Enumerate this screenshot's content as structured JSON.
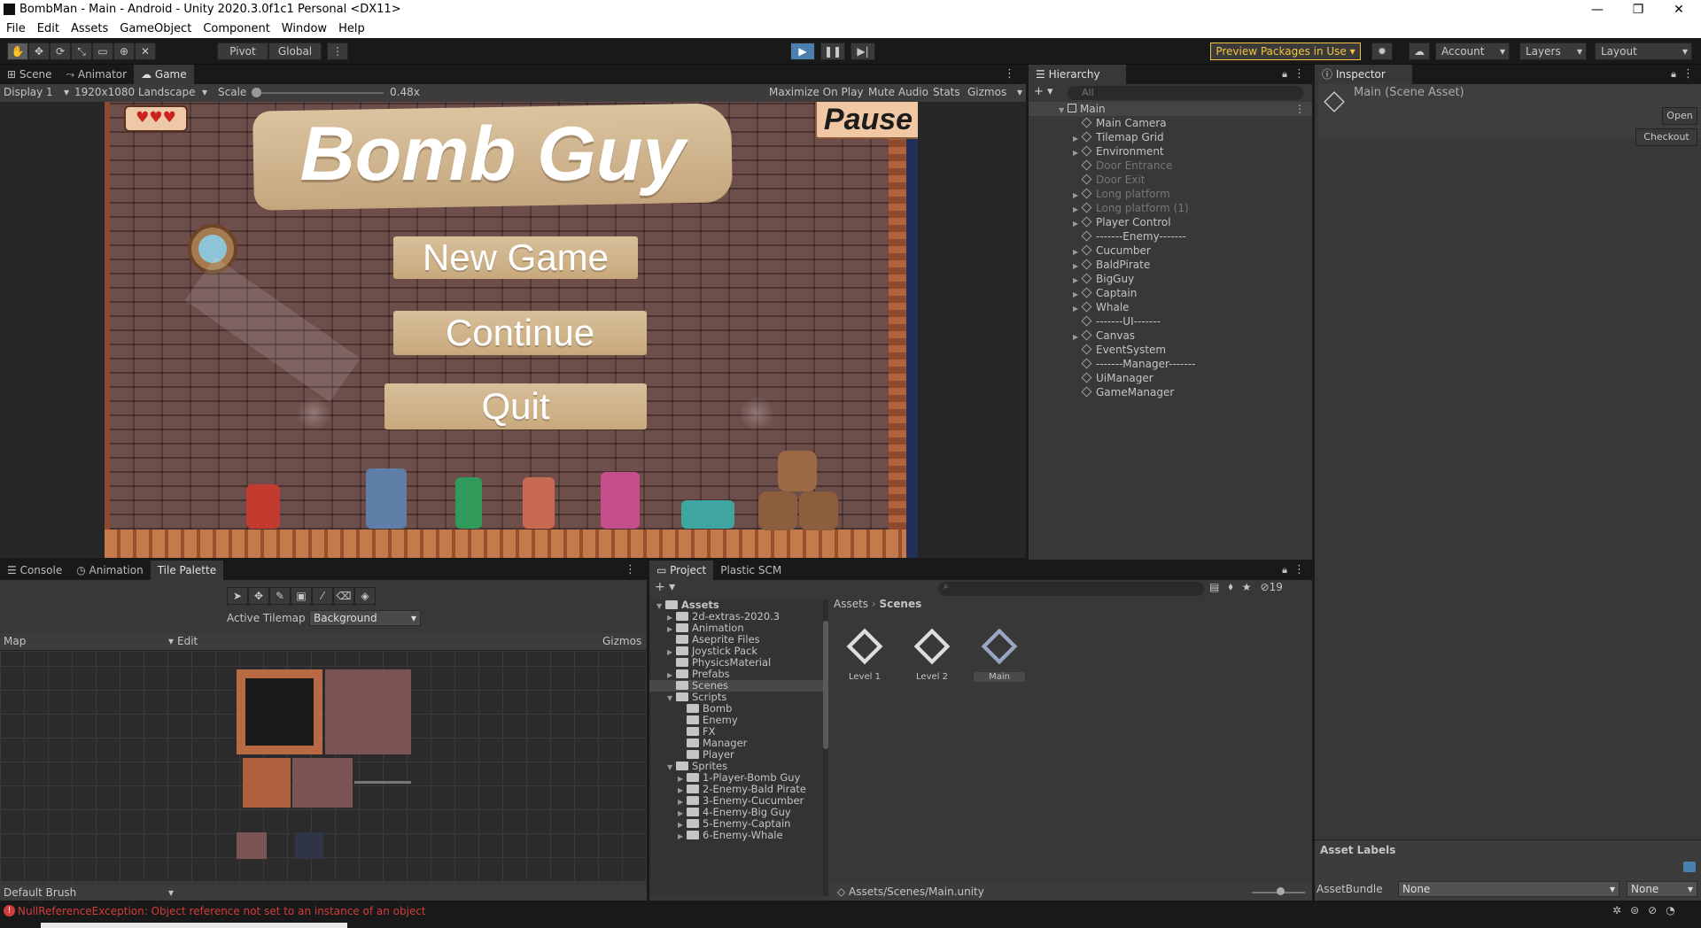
{
  "window": {
    "title": "BombMan - Main - Android - Unity 2020.3.0f1c1 Personal <DX11>"
  },
  "menu": [
    "File",
    "Edit",
    "Assets",
    "GameObject",
    "Component",
    "Window",
    "Help"
  ],
  "toolbar": {
    "pivot": "Pivot",
    "global": "Global",
    "preview_packages": "Preview Packages in Use",
    "account": "Account",
    "layers": "Layers",
    "layout": "Layout"
  },
  "game_panel": {
    "tabs": [
      "Scene",
      "Animator",
      "Game"
    ],
    "display": "Display 1",
    "resolution": "1920x1080 Landscape",
    "scale_label": "Scale",
    "scale_value": "0.48x",
    "scale_fraction": 0.05,
    "maximize": "Maximize On Play",
    "mute": "Mute Audio",
    "stats": "Stats",
    "gizmos": "Gizmos"
  },
  "game_view": {
    "title": "Bomb Guy",
    "pause": "Pause",
    "buttons": [
      "New Game",
      "Continue",
      "Quit"
    ],
    "hearts": "♥♥♥"
  },
  "hierarchy": {
    "tab": "Hierarchy",
    "search_placeholder": "All",
    "scene": "Main",
    "items": [
      {
        "label": "Main Camera",
        "arrow": false,
        "dim": false
      },
      {
        "label": "Tilemap Grid",
        "arrow": true,
        "dim": false
      },
      {
        "label": "Environment",
        "arrow": true,
        "dim": false
      },
      {
        "label": "Door Entrance",
        "arrow": false,
        "dim": true
      },
      {
        "label": "Door Exit",
        "arrow": false,
        "dim": true
      },
      {
        "label": "Long platform",
        "arrow": true,
        "dim": true
      },
      {
        "label": "Long platform (1)",
        "arrow": true,
        "dim": true
      },
      {
        "label": "Player Control",
        "arrow": true,
        "dim": false
      },
      {
        "label": "-------Enemy-------",
        "arrow": false,
        "dim": false
      },
      {
        "label": "Cucumber",
        "arrow": true,
        "dim": false
      },
      {
        "label": "BaldPirate",
        "arrow": true,
        "dim": false
      },
      {
        "label": "BigGuy",
        "arrow": true,
        "dim": false
      },
      {
        "label": "Captain",
        "arrow": true,
        "dim": false
      },
      {
        "label": "Whale",
        "arrow": true,
        "dim": false
      },
      {
        "label": "-------UI-------",
        "arrow": false,
        "dim": false
      },
      {
        "label": "Canvas",
        "arrow": true,
        "dim": false
      },
      {
        "label": "EventSystem",
        "arrow": false,
        "dim": false
      },
      {
        "label": "-------Manager-------",
        "arrow": false,
        "dim": false
      },
      {
        "label": "UiManager",
        "arrow": false,
        "dim": false
      },
      {
        "label": "GameManager",
        "arrow": false,
        "dim": false
      }
    ]
  },
  "inspector": {
    "tab": "Inspector",
    "title": "Main (Scene Asset)",
    "open": "Open",
    "checkout": "Checkout",
    "asset_labels": "Asset Labels",
    "asset_bundle": "AssetBundle",
    "bundle_value": "None",
    "variant_value": "None"
  },
  "tile_palette": {
    "tabs": [
      "Console",
      "Animation",
      "Tile Palette"
    ],
    "active_tilemap_label": "Active Tilemap",
    "active_tilemap_value": "Background",
    "map": "Map",
    "edit": "Edit",
    "gizmos": "Gizmos",
    "brush": "Default Brush"
  },
  "project": {
    "tabs": [
      "Project",
      "Plastic SCM"
    ],
    "hidden_count": "19",
    "breadcrumb_root": "Assets",
    "breadcrumb_leaf": "Scenes",
    "tree": [
      {
        "label": "Assets",
        "depth": 0,
        "open": true,
        "arrow": true,
        "bold": true
      },
      {
        "label": "2d-extras-2020.3",
        "depth": 1,
        "arrow": true
      },
      {
        "label": "Animation",
        "depth": 1,
        "arrow": true
      },
      {
        "label": "Aseprite Files",
        "depth": 1,
        "arrow": false
      },
      {
        "label": "Joystick Pack",
        "depth": 1,
        "arrow": true
      },
      {
        "label": "PhysicsMaterial",
        "depth": 1,
        "arrow": false
      },
      {
        "label": "Prefabs",
        "depth": 1,
        "arrow": true
      },
      {
        "label": "Scenes",
        "depth": 1,
        "arrow": false,
        "selected": true
      },
      {
        "label": "Scripts",
        "depth": 1,
        "open": true,
        "arrow": true
      },
      {
        "label": "Bomb",
        "depth": 2,
        "arrow": false
      },
      {
        "label": "Enemy",
        "depth": 2,
        "arrow": false
      },
      {
        "label": "FX",
        "depth": 2,
        "arrow": false
      },
      {
        "label": "Manager",
        "depth": 2,
        "arrow": false
      },
      {
        "label": "Player",
        "depth": 2,
        "arrow": false
      },
      {
        "label": "Sprites",
        "depth": 1,
        "open": true,
        "arrow": true
      },
      {
        "label": "1-Player-Bomb Guy",
        "depth": 2,
        "arrow": true
      },
      {
        "label": "2-Enemy-Bald Pirate",
        "depth": 2,
        "arrow": true
      },
      {
        "label": "3-Enemy-Cucumber",
        "depth": 2,
        "arrow": true
      },
      {
        "label": "4-Enemy-Big Guy",
        "depth": 2,
        "arrow": true
      },
      {
        "label": "5-Enemy-Captain",
        "depth": 2,
        "arrow": true
      },
      {
        "label": "6-Enemy-Whale",
        "depth": 2,
        "arrow": true
      }
    ],
    "assets": [
      "Level 1",
      "Level 2",
      "Main"
    ],
    "path": "Assets/Scenes/Main.unity"
  },
  "status": {
    "error": "NullReferenceException: Object reference not set to an instance of an object"
  },
  "colors": {
    "accent": "#f2c440",
    "selection": "#2c5d87",
    "error": "#d33c3c"
  }
}
